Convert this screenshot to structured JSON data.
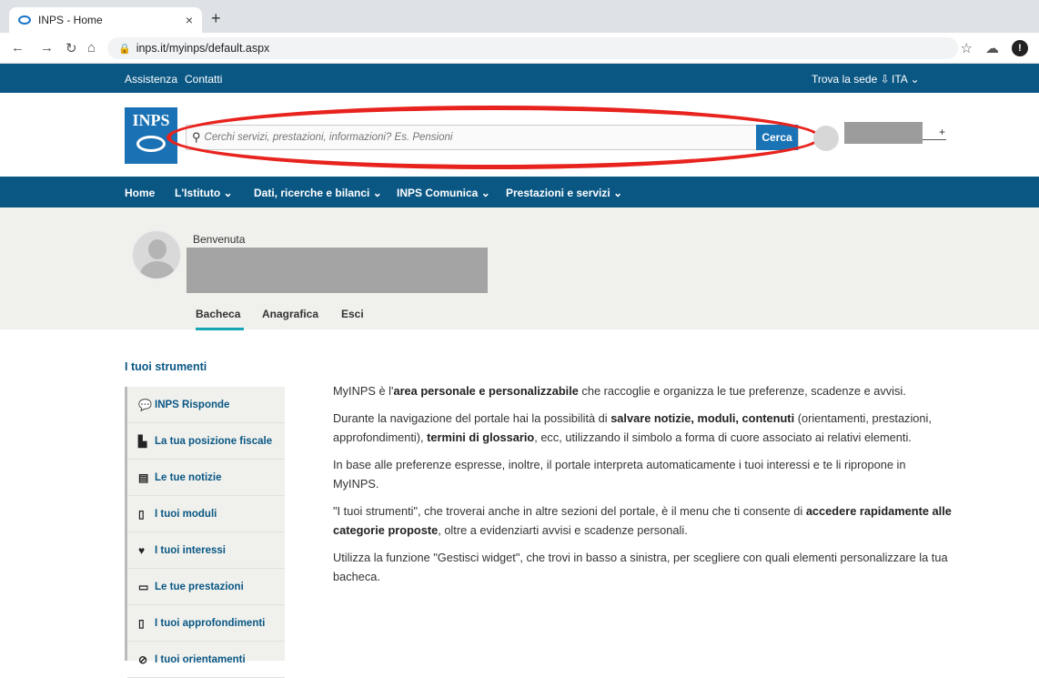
{
  "browser": {
    "tab_title": "INPS - Home",
    "tab_close": "×",
    "new_tab": "+",
    "url": "inps.it/myinps/default.aspx"
  },
  "topbar": {
    "assistenza": "Assistenza",
    "contatti": "Contatti",
    "trova_sede": "Trova la sede",
    "lang": "ITA"
  },
  "header": {
    "logo_text": "INPS",
    "search_placeholder": "Cerchi servizi, prestazioni, informazioni? Es. Pensioni",
    "search_button": "Cerca",
    "user_plus": "+"
  },
  "mainnav": [
    "Home",
    "L'Istituto",
    "Dati, ricerche e bilanci",
    "INPS Comunica",
    "Prestazioni e servizi"
  ],
  "profile": {
    "welcome": "Benvenuta",
    "tabs": [
      "Bacheca",
      "Anagrafica",
      "Esci"
    ]
  },
  "tools": {
    "title": "I tuoi strumenti",
    "items": [
      {
        "label": "INPS Risponde",
        "icon": "chat-icon"
      },
      {
        "label": "La tua posizione fiscale",
        "icon": "documents-icon"
      },
      {
        "label": "Le tue notizie",
        "icon": "newspaper-icon"
      },
      {
        "label": "I tuoi moduli",
        "icon": "document-icon"
      },
      {
        "label": "I tuoi interessi",
        "icon": "heart-icon"
      },
      {
        "label": "Le tue prestazioni",
        "icon": "inbox-icon"
      },
      {
        "label": "I tuoi approfondimenti",
        "icon": "document-icon"
      },
      {
        "label": "I tuoi orientamenti",
        "icon": "compass-icon"
      }
    ]
  },
  "content": {
    "p1_a": "MyINPS è l'",
    "p1_b": "area personale e personalizzabile",
    "p1_c": " che raccoglie e organizza le tue preferenze, scadenze e avvisi.",
    "p2_a": "Durante la navigazione del portale hai la possibilità di ",
    "p2_b": "salvare notizie, moduli, contenuti",
    "p2_c": " (orientamenti, prestazioni, approfondimenti), ",
    "p2_d": "termini di glossario",
    "p2_e": ", ecc, utilizzando il simbolo a forma di cuore associato ai relativi elementi.",
    "p3": "In base alle preferenze espresse, inoltre, il portale interpreta automaticamente i tuoi interessi e te li ripropone in MyINPS.",
    "p4_a": "\"I tuoi strumenti\", che troverai anche in altre sezioni del portale, è il menu che ti consente di ",
    "p4_b": "accedere rapidamente alle categorie proposte",
    "p4_c": ", oltre a evidenziarti avvisi e scadenze personali.",
    "p5": "Utilizza la funzione \"Gestisci widget\", che trovi in basso a sinistra, per scegliere con quali elementi personalizzare la tua bacheca."
  },
  "colors": {
    "brand_blue": "#0a5784",
    "button_blue": "#1a73b5",
    "highlight_red": "#e8231e",
    "tab_underline": "#15a5b4"
  }
}
